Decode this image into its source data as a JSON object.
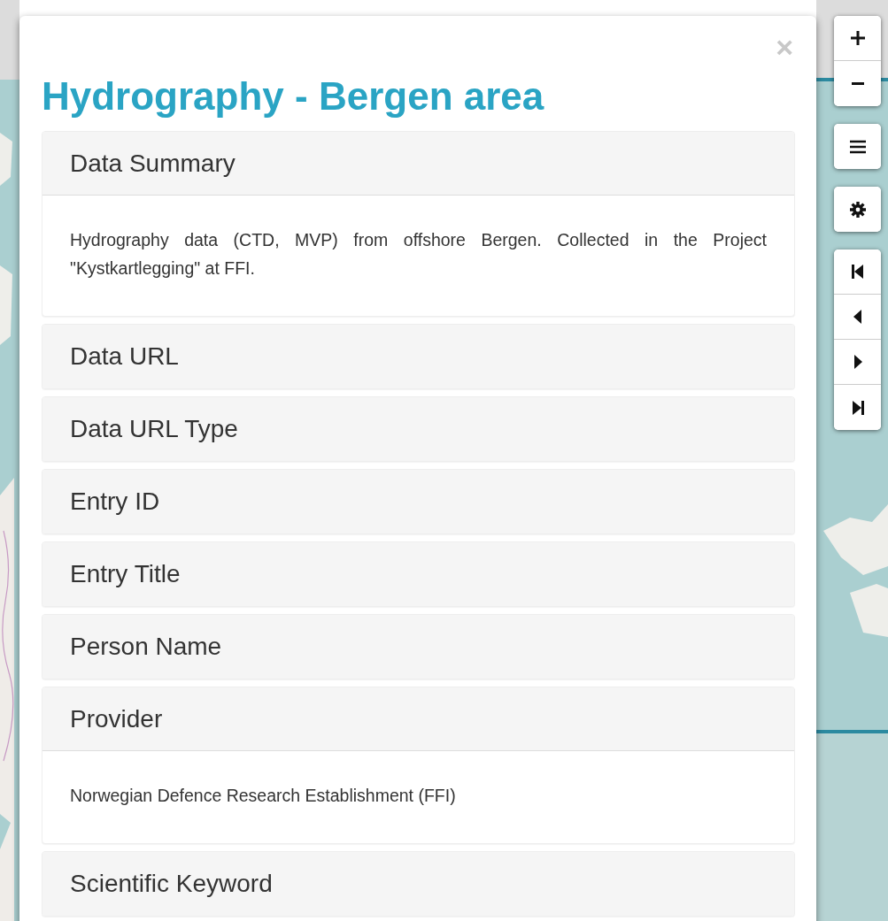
{
  "dialog": {
    "title": "Hydrography - Bergen area",
    "close": "×",
    "panels": [
      {
        "heading": "Data Summary",
        "expanded": true,
        "body": "Hydrography data (CTD, MVP) from offshore Bergen. Collected in the Project \"Kystkartlegging\" at FFI."
      },
      {
        "heading": "Data URL",
        "expanded": false
      },
      {
        "heading": "Data URL Type",
        "expanded": false
      },
      {
        "heading": "Entry ID",
        "expanded": false
      },
      {
        "heading": "Entry Title",
        "expanded": false
      },
      {
        "heading": "Person Name",
        "expanded": false
      },
      {
        "heading": "Provider",
        "expanded": true,
        "body": "Norwegian Defence Research Establishment (FFI)"
      },
      {
        "heading": "Scientific Keyword",
        "expanded": false
      }
    ]
  }
}
